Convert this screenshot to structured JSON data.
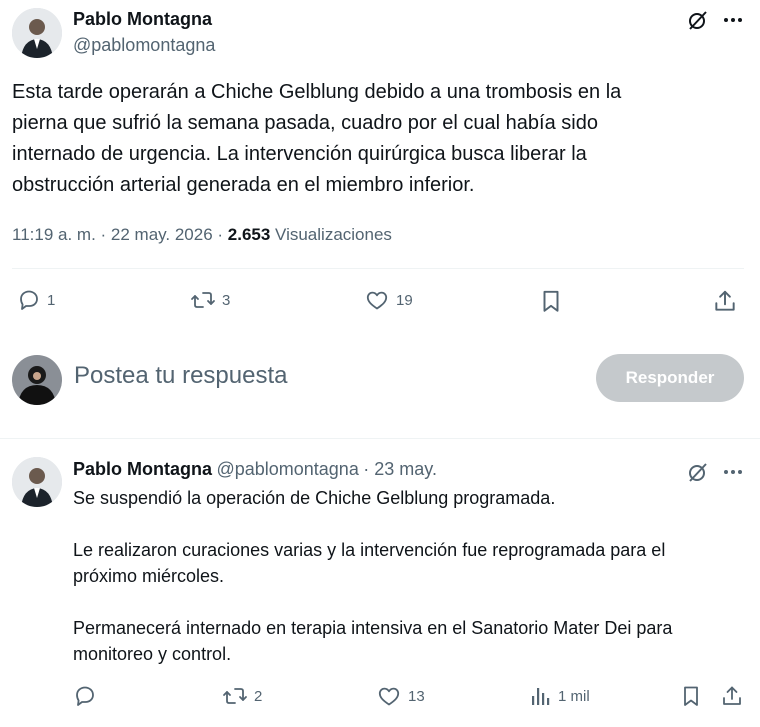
{
  "main_tweet": {
    "author_name": "Pablo Montagna",
    "author_handle": "@pablomontagna",
    "text_lines": [
      "Esta tarde operarán a Chiche Gelblung debido a una trombosis en la",
      "pierna que sufrió la semana pasada, cuadro por el cual había sido",
      "internado de urgencia. La intervención quirúrgica busca liberar la",
      "obstrucción arterial generada en el miembro inferior."
    ],
    "meta": {
      "time_date": "11:19 a. m. · 22 may. 2026 · ",
      "views_count": "2.653",
      "views_label": "Visualizaciones"
    },
    "actions": {
      "replies": "1",
      "retweets": "3",
      "likes": "19"
    }
  },
  "reply_composer": {
    "placeholder": "Postea tu respuesta",
    "button_label": "Responder"
  },
  "reply_tweet": {
    "author_name": "Pablo Montagna",
    "author_handle": "@pablomontagna",
    "date": "· 23 may.",
    "paragraphs": [
      "Se suspendió la operación de Chiche Gelblung programada.",
      "Le realizaron curaciones varias y la intervención fue reprogramada para el\npróximo miércoles.",
      "Permanecerá internado en terapia intensiva en el Sanatorio Mater Dei para\nmonitoreo y control."
    ],
    "actions": {
      "retweets": "2",
      "likes": "13",
      "views": "1 mil"
    }
  },
  "icons": {
    "grok": "grok-icon",
    "more": "more-icon",
    "reply": "reply-icon",
    "retweet": "retweet-icon",
    "like": "like-icon",
    "bookmark": "bookmark-icon",
    "share": "share-icon",
    "views": "views-icon"
  },
  "colors": {
    "text": "#0f1419",
    "muted": "#536471",
    "divider": "#eff3f4",
    "button_disabled": "#c5c9cc"
  }
}
